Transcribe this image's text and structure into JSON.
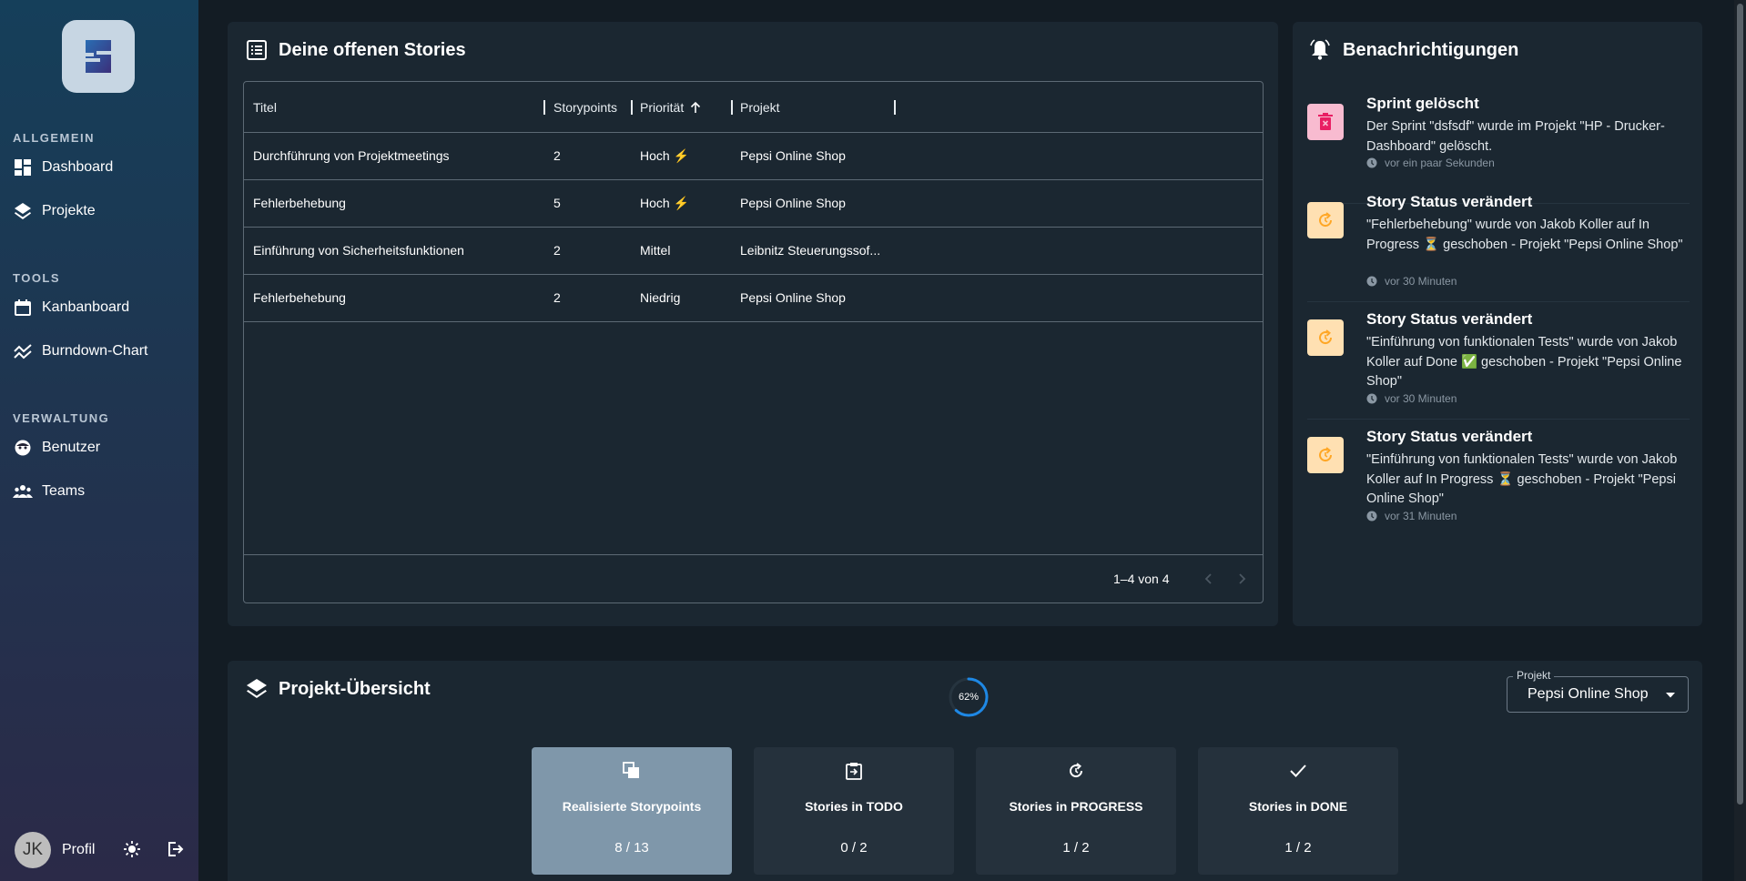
{
  "sidebar": {
    "sections": [
      {
        "label": "ALLGEMEIN",
        "items": [
          {
            "label": "Dashboard",
            "icon": "dashboard-icon"
          },
          {
            "label": "Projekte",
            "icon": "layers-icon"
          }
        ]
      },
      {
        "label": "TOOLS",
        "items": [
          {
            "label": "Kanbanboard",
            "icon": "calendar-icon"
          },
          {
            "label": "Burndown-Chart",
            "icon": "chart-line-icon"
          }
        ]
      },
      {
        "label": "VERWALTUNG",
        "items": [
          {
            "label": "Benutzer",
            "icon": "face-icon"
          },
          {
            "label": "Teams",
            "icon": "group-icon"
          }
        ]
      }
    ],
    "profile": {
      "initials": "JK",
      "label": "Profil"
    }
  },
  "stories": {
    "title": "Deine offenen Stories",
    "columns": [
      "Titel",
      "Storypoints",
      "Priorität",
      "Projekt"
    ],
    "rows": [
      {
        "title": "Durchführung von Projektmeetings",
        "points": "2",
        "priority": "Hoch ⚡",
        "project": "Pepsi Online Shop"
      },
      {
        "title": "Fehlerbehebung",
        "points": "5",
        "priority": "Hoch ⚡",
        "project": "Pepsi Online Shop"
      },
      {
        "title": "Einführung von Sicherheitsfunktionen",
        "points": "2",
        "priority": "Mittel",
        "project": "Leibnitz Steuerungssof..."
      },
      {
        "title": "Fehlerbehebung",
        "points": "2",
        "priority": "Niedrig",
        "project": "Pepsi Online Shop"
      }
    ],
    "pagination": "1–4 von 4"
  },
  "notifications": {
    "title": "Benachrichtigungen",
    "items": [
      {
        "title": "Sprint gelöscht",
        "body": "Der Sprint \"dsfsdf\" wurde im Projekt \"HP - Drucker-Dashboard\" gelöscht.",
        "time": "vor ein paar Sekunden",
        "type": "delete"
      },
      {
        "title": "Story Status verändert",
        "body": "\"Fehlerbehebung\" wurde von Jakob Koller auf In Progress ⏳ geschoben - Projekt \"Pepsi Online Shop\"",
        "time": "vor 30 Minuten",
        "type": "status"
      },
      {
        "title": "Story Status verändert",
        "body": "\"Einführung von funktionalen Tests\" wurde von Jakob Koller auf Done ✅ geschoben - Projekt \"Pepsi Online Shop\"",
        "time": "vor 30 Minuten",
        "type": "status"
      },
      {
        "title": "Story Status verändert",
        "body": "\"Einführung von funktionalen Tests\" wurde von Jakob Koller auf In Progress ⏳ geschoben - Projekt \"Pepsi Online Shop\"",
        "time": "vor 31 Minuten",
        "type": "status"
      }
    ]
  },
  "overview": {
    "title": "Projekt-Übersicht",
    "progress_percent": 62,
    "progress_label": "62%",
    "project_select_label": "Projekt",
    "project_selected": "Pepsi Online Shop",
    "stats": [
      {
        "label": "Realisierte Storypoints",
        "value": "8 / 13",
        "icon": "copy-icon"
      },
      {
        "label": "Stories in TODO",
        "value": "0 / 2",
        "icon": "clipboard-icon"
      },
      {
        "label": "Stories in PROGRESS",
        "value": "1 / 2",
        "icon": "refresh-icon"
      },
      {
        "label": "Stories in DONE",
        "value": "1 / 2",
        "icon": "check-icon"
      }
    ]
  },
  "colors": {
    "accent": "#1e88e5",
    "delete_bg": "#f8bbd0",
    "delete_fg": "#e91e63",
    "status_bg": "#ffe0b2",
    "status_fg": "#ffa726"
  }
}
